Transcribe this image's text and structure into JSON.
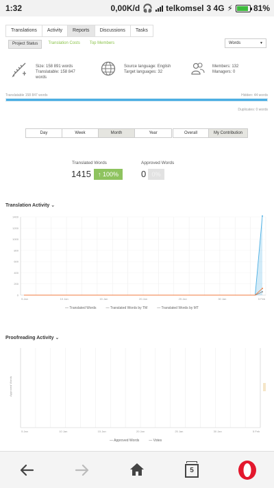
{
  "status_bar": {
    "time": "1:32",
    "speed": "0,00K/d",
    "carrier": "telkomsel",
    "network": "3 4G",
    "battery": "81%"
  },
  "tabs": [
    {
      "label": "Translations",
      "active": false
    },
    {
      "label": "Activity",
      "active": false
    },
    {
      "label": "Reports",
      "active": true
    },
    {
      "label": "Discussions",
      "active": false
    },
    {
      "label": "Tasks",
      "active": false
    }
  ],
  "subtabs": [
    {
      "label": "Project Status",
      "active": true
    },
    {
      "label": "Translation Costs",
      "active": false
    },
    {
      "label": "Top Members",
      "active": false
    }
  ],
  "unit_select": {
    "value": "Words"
  },
  "project": {
    "size": "Size: 158 891 words",
    "translatable": "Translatable: 158 847",
    "translatable_unit": "words",
    "source_language": "Source language: English",
    "target_languages": "Target languages: 32",
    "members": "Members: 132",
    "managers": "Managers: 0"
  },
  "progress": {
    "left_label": "Translatable 158 847 words",
    "right_label": "Hidden: 44 words",
    "below_label": "Duplicates: 0 words",
    "fraction": 1.0
  },
  "periods": [
    {
      "label": "Day",
      "active": false
    },
    {
      "label": "Week",
      "active": false
    },
    {
      "label": "Month",
      "active": true
    },
    {
      "label": "Year",
      "active": false
    }
  ],
  "scopes": [
    {
      "label": "Overall",
      "active": false
    },
    {
      "label": "My Contribution",
      "active": true
    }
  ],
  "stats": {
    "translated_label": "Translated Words",
    "translated_value": "1415",
    "translated_badge": "↑ 100%",
    "approved_label": "Approved Words",
    "approved_value": "0",
    "approved_badge": "0%"
  },
  "translation_activity": {
    "title": "Translation Activity",
    "legend": [
      "Translated Words",
      "Translated Words by TM",
      "Translated Words by MT"
    ],
    "colors": {
      "translated": "#4aaee3",
      "tm": "#888888",
      "mt": "#f07a3c"
    }
  },
  "proofreading_activity": {
    "title": "Proofreading Activity",
    "legend": [
      "Approved Words",
      "Votes"
    ],
    "y_axis_label": "Approved Words"
  },
  "nav": {
    "tab_count": "5"
  },
  "chart_data": [
    {
      "type": "area",
      "title": "Translation Activity",
      "y_ticks": [
        "1400",
        "1200",
        "1000",
        "800",
        "600",
        "400",
        "200",
        "0"
      ],
      "ylim": [
        0,
        1400
      ],
      "x_tick_labels": [
        "5 Jan",
        "10 Jan",
        "15 Jan",
        "20 Jan",
        "25 Jan",
        "30 Jan",
        "5 Feb"
      ],
      "series": [
        {
          "name": "Translated Words",
          "values": [
            0,
            0,
            0,
            0,
            0,
            0,
            0,
            0,
            0,
            0,
            0,
            0,
            0,
            0,
            0,
            0,
            0,
            0,
            0,
            0,
            0,
            0,
            0,
            0,
            0,
            0,
            0,
            0,
            0,
            0,
            0,
            0,
            0,
            1415
          ]
        },
        {
          "name": "Translated Words by TM",
          "values": [
            0,
            0,
            0,
            0,
            0,
            0,
            0,
            0,
            0,
            0,
            0,
            0,
            0,
            0,
            0,
            0,
            0,
            0,
            0,
            0,
            0,
            0,
            0,
            0,
            0,
            0,
            0,
            0,
            0,
            0,
            0,
            0,
            0,
            60
          ]
        },
        {
          "name": "Translated Words by MT",
          "values": [
            0,
            0,
            0,
            0,
            0,
            0,
            0,
            0,
            0,
            0,
            0,
            0,
            0,
            0,
            0,
            0,
            0,
            0,
            0,
            0,
            0,
            0,
            0,
            0,
            0,
            0,
            0,
            0,
            0,
            0,
            0,
            0,
            0,
            120
          ]
        }
      ]
    },
    {
      "type": "line",
      "title": "Proofreading Activity",
      "ylabel": "Approved Words",
      "x_tick_labels": [
        "5 Jan",
        "10 Jan",
        "15 Jan",
        "20 Jan",
        "25 Jan",
        "30 Jan",
        "5 Feb"
      ],
      "series": [
        {
          "name": "Approved Words",
          "values": []
        },
        {
          "name": "Votes",
          "values": []
        }
      ]
    }
  ]
}
